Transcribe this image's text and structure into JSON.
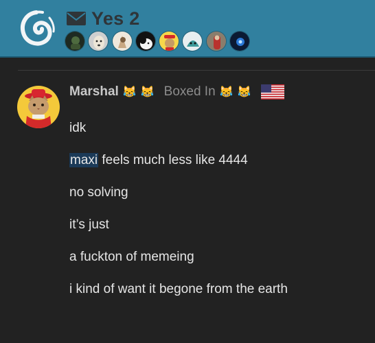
{
  "header": {
    "title": "Yes 2",
    "envelope_icon": "envelope-icon",
    "participants": [
      {
        "name": "participant-avatar-1",
        "style": "dark-green-figure"
      },
      {
        "name": "participant-avatar-2",
        "style": "dog"
      },
      {
        "name": "participant-avatar-3",
        "style": "cat-figure"
      },
      {
        "name": "participant-avatar-4",
        "style": "black-white-cat"
      },
      {
        "name": "participant-avatar-5",
        "style": "cowboy-cat"
      },
      {
        "name": "participant-avatar-6",
        "style": "teal-creature"
      },
      {
        "name": "participant-avatar-7",
        "style": "red-figure"
      },
      {
        "name": "participant-avatar-8",
        "style": "blue-glow"
      }
    ]
  },
  "post": {
    "username": "Marshal",
    "name_emojis": [
      "😹",
      "😹"
    ],
    "user_title": "Boxed In",
    "title_emojis": [
      "😹",
      "😹"
    ],
    "flag": "us-flag-icon",
    "messages": [
      {
        "highlight": "",
        "text": "idk"
      },
      {
        "highlight": "maxi",
        "text": " feels much less like 4444"
      },
      {
        "highlight": "",
        "text": "no solving"
      },
      {
        "highlight": "",
        "text": "it’s just"
      },
      {
        "highlight": "",
        "text": "a fuckton of memeing"
      },
      {
        "highlight": "",
        "text": "i kind of want it begone from the earth"
      }
    ]
  },
  "colors": {
    "header_bg": "#31809f",
    "page_bg": "#222222",
    "title": "#2f3539",
    "username": "#c9c9c9",
    "user_title": "#8c8c8c",
    "message_text": "#e6e6e6",
    "highlight_bg": "#1b3a58"
  }
}
